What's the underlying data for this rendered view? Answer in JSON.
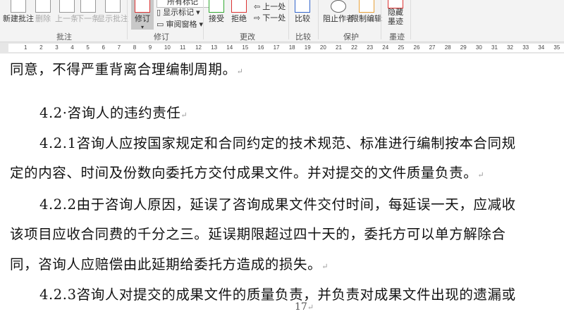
{
  "ribbon": {
    "comments": {
      "new": "新建批注",
      "delete": "删除",
      "prev": "上一条",
      "next": "下一条",
      "show": "显示批注",
      "group": "批注"
    },
    "tracking": {
      "track": "修订",
      "all_markup": "所有标记",
      "show_markup": "显示标记",
      "review_pane": "审阅窗格",
      "group": "修订"
    },
    "changes": {
      "accept": "接受",
      "reject": "拒绝",
      "prev": "上一处",
      "next": "下一处",
      "group": "更改"
    },
    "compare": {
      "compare": "比较",
      "group": "比较"
    },
    "protect": {
      "block": "阻止作者",
      "restrict": "限制编辑",
      "group": "保护"
    },
    "ink": {
      "hide1": "隐藏",
      "hide2": "墨迹",
      "group": "墨迹"
    }
  },
  "ruler": [
    "1",
    "2",
    "3",
    "4",
    "5",
    "6",
    "7",
    "8",
    "9",
    "10",
    "11",
    "12",
    "13",
    "14",
    "15",
    "16",
    "17",
    "18",
    "19",
    "20",
    "21",
    "22",
    "23",
    "24",
    "25",
    "26",
    "27",
    "28",
    "29",
    "30",
    "31",
    "32",
    "33",
    "34",
    "35"
  ],
  "document": {
    "lines": [
      "同意，不得严重背离合理编制周期。",
      "4.2·咨询人的违约责任",
      "4.2.1咨询人应按国家规定和合同约定的技术规范、标准进行编制按本合同规",
      "定的内容、时间及份数向委托方交付成果文件。并对提交的文件质量负责。",
      "4.2.2由于咨询人原因，延误了咨询成果文件交付时间，每延误一天，应减收",
      "该项目应收合同费的千分之三。延误期限超过四十天的，委托方可以单方解除合",
      "同，咨询人应赔偿由此延期给委托方造成的损失。",
      "4.2.3咨询人对提交的成果文件的质量负责，并负责对成果文件出现的遗漏或"
    ],
    "para_mark": "↵",
    "page_number": "17"
  }
}
